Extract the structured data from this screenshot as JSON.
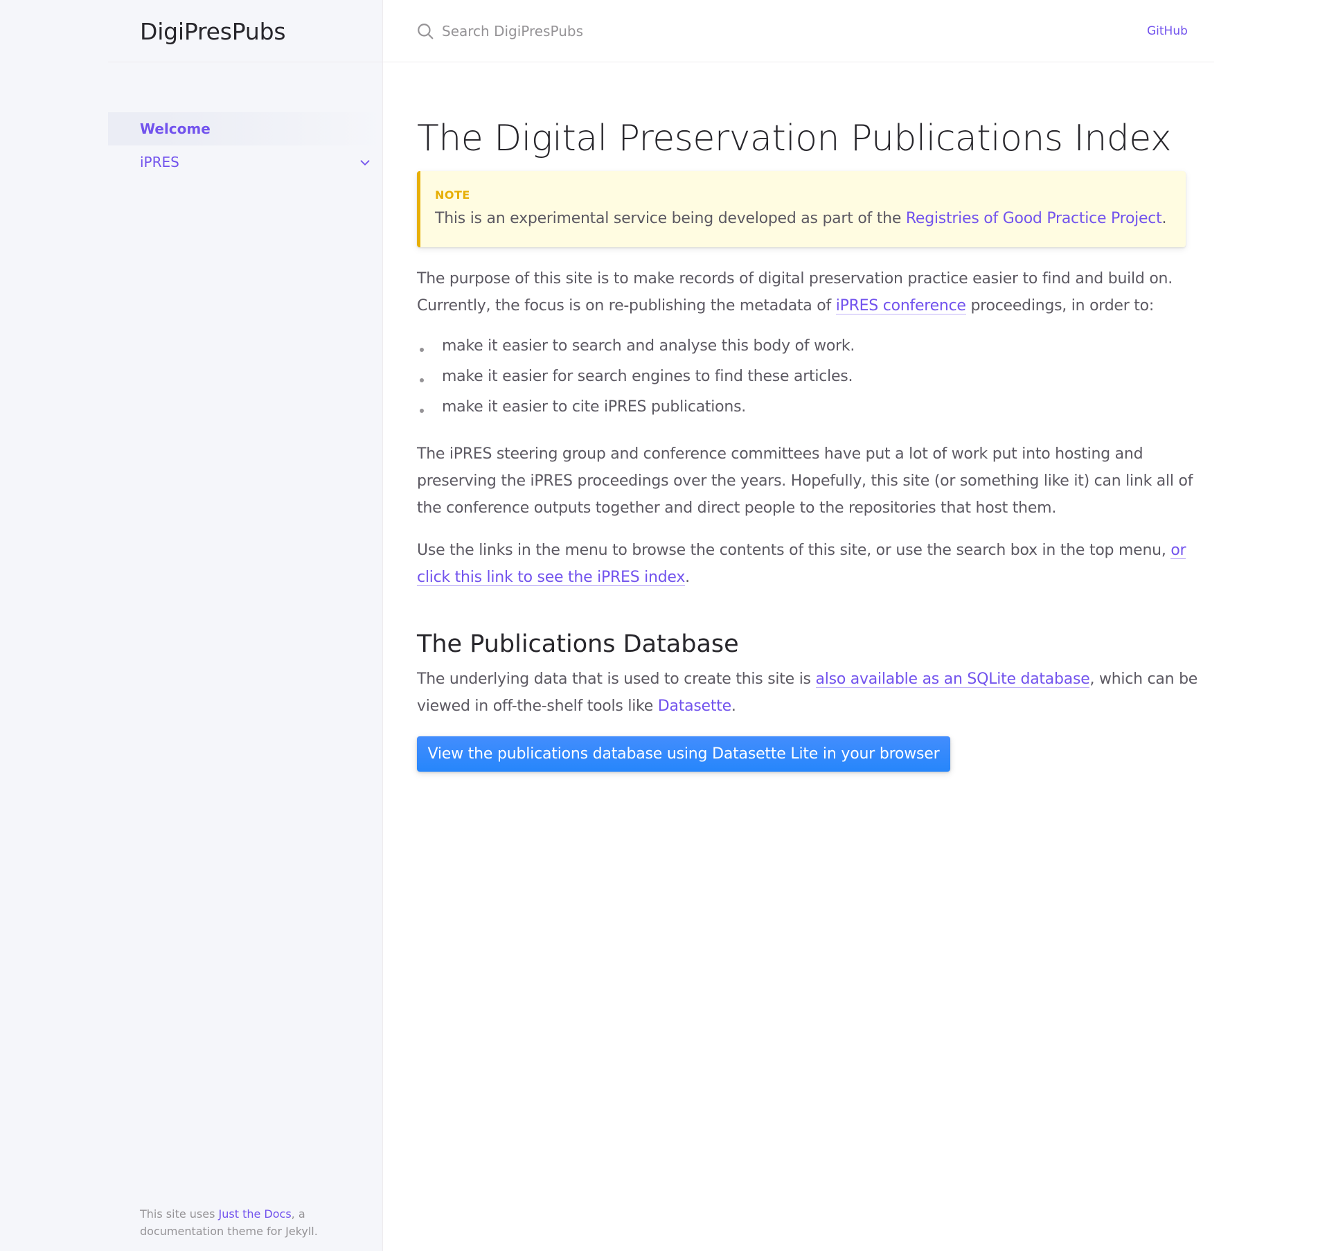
{
  "site": {
    "title": "DigiPresPubs"
  },
  "search": {
    "placeholder": "Search DigiPresPubs",
    "icon": "search-icon"
  },
  "header": {
    "github_label": "GitHub"
  },
  "sidebar": {
    "items": [
      {
        "label": "Welcome",
        "active": true
      },
      {
        "label": "iPRES",
        "active": false,
        "expandable": true
      }
    ],
    "footer": {
      "prefix": "This site uses ",
      "link": "Just the Docs",
      "suffix": ", a documentation theme for Jekyll."
    }
  },
  "main": {
    "title": "The Digital Preservation Publications Index",
    "note": {
      "label": "NOTE",
      "text_prefix": "This is an experimental service being developed as part of the ",
      "link": "Registries of Good Practice Project",
      "text_suffix": "."
    },
    "intro": {
      "line1": "The purpose of this site is to make records of digital preservation practice easier to find and build on.",
      "line2_prefix": "Currently, the focus is on re-publishing the metadata of ",
      "line2_link": "iPRES conference",
      "line2_suffix": " proceedings, in order to:"
    },
    "bullets": [
      "make it easier to search and analyse this body of work.",
      "make it easier for search engines to find these articles.",
      "make it easier to cite iPRES publications."
    ],
    "steering": {
      "line1": "The iPRES steering group and conference committees have put a lot of work put into hosting and",
      "line2": "preserving the iPRES proceedings over the years. Hopefully, this site (or something like it) can link all of",
      "line3": "the conference outputs together and direct people to the repositories that host them."
    },
    "links_para": {
      "line1_prefix": "Use the links in the menu to browse the contents of this site, or use the search box in the top menu, ",
      "line1_link": "or",
      "line2_link": "click this link to see the iPRES index",
      "line2_suffix": "."
    },
    "db_heading": "The Publications Database",
    "db_para": {
      "line1_prefix": "The underlying data that is used to create this site is ",
      "line1_link": "also available as an SQLite database",
      "line1_suffix": ", which can be",
      "line2_prefix": "viewed in off-the-shelf tools like ",
      "line2_link": "Datasette",
      "line2_suffix": "."
    },
    "button_label": "View the publications database using Datasette Lite in your browser"
  },
  "colors": {
    "link": "#7253ed",
    "note_accent": "#e7af06",
    "button": "#2686fb"
  }
}
